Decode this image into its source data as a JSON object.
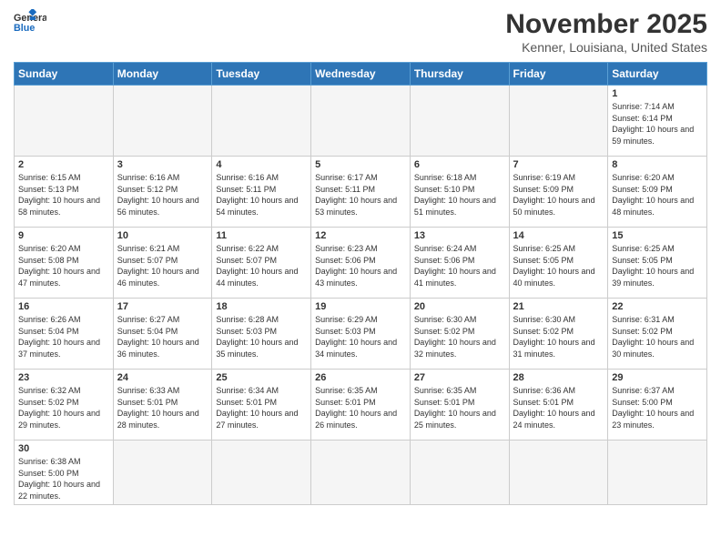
{
  "header": {
    "logo_general": "General",
    "logo_blue": "Blue",
    "month_title": "November 2025",
    "location": "Kenner, Louisiana, United States"
  },
  "days_of_week": [
    "Sunday",
    "Monday",
    "Tuesday",
    "Wednesday",
    "Thursday",
    "Friday",
    "Saturday"
  ],
  "weeks": [
    [
      {
        "day": "",
        "info": ""
      },
      {
        "day": "",
        "info": ""
      },
      {
        "day": "",
        "info": ""
      },
      {
        "day": "",
        "info": ""
      },
      {
        "day": "",
        "info": ""
      },
      {
        "day": "",
        "info": ""
      },
      {
        "day": "1",
        "info": "Sunrise: 7:14 AM\nSunset: 6:14 PM\nDaylight: 10 hours and 59 minutes."
      }
    ],
    [
      {
        "day": "2",
        "info": "Sunrise: 6:15 AM\nSunset: 5:13 PM\nDaylight: 10 hours and 58 minutes."
      },
      {
        "day": "3",
        "info": "Sunrise: 6:16 AM\nSunset: 5:12 PM\nDaylight: 10 hours and 56 minutes."
      },
      {
        "day": "4",
        "info": "Sunrise: 6:16 AM\nSunset: 5:11 PM\nDaylight: 10 hours and 54 minutes."
      },
      {
        "day": "5",
        "info": "Sunrise: 6:17 AM\nSunset: 5:11 PM\nDaylight: 10 hours and 53 minutes."
      },
      {
        "day": "6",
        "info": "Sunrise: 6:18 AM\nSunset: 5:10 PM\nDaylight: 10 hours and 51 minutes."
      },
      {
        "day": "7",
        "info": "Sunrise: 6:19 AM\nSunset: 5:09 PM\nDaylight: 10 hours and 50 minutes."
      },
      {
        "day": "8",
        "info": "Sunrise: 6:20 AM\nSunset: 5:09 PM\nDaylight: 10 hours and 48 minutes."
      }
    ],
    [
      {
        "day": "9",
        "info": "Sunrise: 6:20 AM\nSunset: 5:08 PM\nDaylight: 10 hours and 47 minutes."
      },
      {
        "day": "10",
        "info": "Sunrise: 6:21 AM\nSunset: 5:07 PM\nDaylight: 10 hours and 46 minutes."
      },
      {
        "day": "11",
        "info": "Sunrise: 6:22 AM\nSunset: 5:07 PM\nDaylight: 10 hours and 44 minutes."
      },
      {
        "day": "12",
        "info": "Sunrise: 6:23 AM\nSunset: 5:06 PM\nDaylight: 10 hours and 43 minutes."
      },
      {
        "day": "13",
        "info": "Sunrise: 6:24 AM\nSunset: 5:06 PM\nDaylight: 10 hours and 41 minutes."
      },
      {
        "day": "14",
        "info": "Sunrise: 6:25 AM\nSunset: 5:05 PM\nDaylight: 10 hours and 40 minutes."
      },
      {
        "day": "15",
        "info": "Sunrise: 6:25 AM\nSunset: 5:05 PM\nDaylight: 10 hours and 39 minutes."
      }
    ],
    [
      {
        "day": "16",
        "info": "Sunrise: 6:26 AM\nSunset: 5:04 PM\nDaylight: 10 hours and 37 minutes."
      },
      {
        "day": "17",
        "info": "Sunrise: 6:27 AM\nSunset: 5:04 PM\nDaylight: 10 hours and 36 minutes."
      },
      {
        "day": "18",
        "info": "Sunrise: 6:28 AM\nSunset: 5:03 PM\nDaylight: 10 hours and 35 minutes."
      },
      {
        "day": "19",
        "info": "Sunrise: 6:29 AM\nSunset: 5:03 PM\nDaylight: 10 hours and 34 minutes."
      },
      {
        "day": "20",
        "info": "Sunrise: 6:30 AM\nSunset: 5:02 PM\nDaylight: 10 hours and 32 minutes."
      },
      {
        "day": "21",
        "info": "Sunrise: 6:30 AM\nSunset: 5:02 PM\nDaylight: 10 hours and 31 minutes."
      },
      {
        "day": "22",
        "info": "Sunrise: 6:31 AM\nSunset: 5:02 PM\nDaylight: 10 hours and 30 minutes."
      }
    ],
    [
      {
        "day": "23",
        "info": "Sunrise: 6:32 AM\nSunset: 5:02 PM\nDaylight: 10 hours and 29 minutes."
      },
      {
        "day": "24",
        "info": "Sunrise: 6:33 AM\nSunset: 5:01 PM\nDaylight: 10 hours and 28 minutes."
      },
      {
        "day": "25",
        "info": "Sunrise: 6:34 AM\nSunset: 5:01 PM\nDaylight: 10 hours and 27 minutes."
      },
      {
        "day": "26",
        "info": "Sunrise: 6:35 AM\nSunset: 5:01 PM\nDaylight: 10 hours and 26 minutes."
      },
      {
        "day": "27",
        "info": "Sunrise: 6:35 AM\nSunset: 5:01 PM\nDaylight: 10 hours and 25 minutes."
      },
      {
        "day": "28",
        "info": "Sunrise: 6:36 AM\nSunset: 5:01 PM\nDaylight: 10 hours and 24 minutes."
      },
      {
        "day": "29",
        "info": "Sunrise: 6:37 AM\nSunset: 5:00 PM\nDaylight: 10 hours and 23 minutes."
      }
    ],
    [
      {
        "day": "30",
        "info": "Sunrise: 6:38 AM\nSunset: 5:00 PM\nDaylight: 10 hours and 22 minutes."
      },
      {
        "day": "",
        "info": ""
      },
      {
        "day": "",
        "info": ""
      },
      {
        "day": "",
        "info": ""
      },
      {
        "day": "",
        "info": ""
      },
      {
        "day": "",
        "info": ""
      },
      {
        "day": "",
        "info": ""
      }
    ]
  ]
}
